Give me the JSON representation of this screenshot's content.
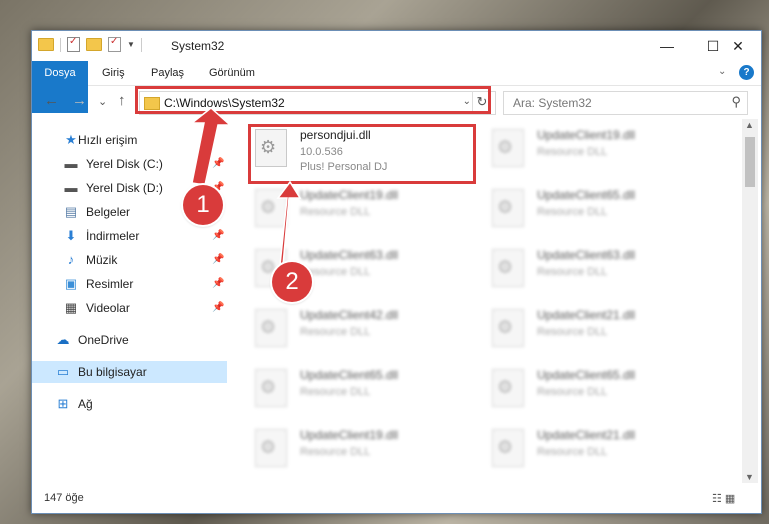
{
  "window": {
    "title": "System32",
    "minimize": "—",
    "maximize": "☐",
    "close": "✕"
  },
  "ribbon": {
    "tabs": [
      "Dosya",
      "Giriş",
      "Paylaş",
      "Görünüm"
    ],
    "help": "?"
  },
  "nav": {
    "back": "←",
    "forward": "→",
    "recent": "⌄",
    "up": "↑",
    "address": "C:\\Windows\\System32",
    "refresh": "↻",
    "search_placeholder": "Ara: System32"
  },
  "sidebar": {
    "items": [
      {
        "label": "Hızlı erişim",
        "icon": "star-icon"
      },
      {
        "label": "Yerel Disk (C:)",
        "icon": "drive-icon"
      },
      {
        "label": "Yerel Disk (D:)",
        "icon": "drive-icon"
      },
      {
        "label": "Belgeler",
        "icon": "documents-icon"
      },
      {
        "label": "İndirmeler",
        "icon": "download-icon"
      },
      {
        "label": "Müzik",
        "icon": "music-icon"
      },
      {
        "label": "Resimler",
        "icon": "pictures-icon"
      },
      {
        "label": "Videolar",
        "icon": "videos-icon"
      },
      {
        "label": "OneDrive",
        "icon": "cloud-icon"
      },
      {
        "label": "Bu bilgisayar",
        "icon": "computer-icon"
      },
      {
        "label": "Ağ",
        "icon": "network-icon"
      }
    ]
  },
  "files": [
    {
      "name": "persondjui.dll",
      "line2": "10.0.536",
      "line3": "Plus! Personal DJ"
    },
    {
      "name": "UpdateClient19.dll",
      "line2": "Resource DLL"
    },
    {
      "name": "UpdateClient19.dll",
      "line2": "Resource DLL"
    },
    {
      "name": "UpdateClient65.dll",
      "line2": "Resource DLL"
    },
    {
      "name": "UpdateClient63.dll",
      "line2": "Resource DLL"
    },
    {
      "name": "UpdateClient63.dll",
      "line2": "Resource DLL"
    },
    {
      "name": "UpdateClient42.dll",
      "line2": "Resource DLL"
    },
    {
      "name": "UpdateClient21.dll",
      "line2": "Resource DLL"
    },
    {
      "name": "UpdateClient65.dll",
      "line2": "Resource DLL"
    },
    {
      "name": "UpdateClient65.dll",
      "line2": "Resource DLL"
    },
    {
      "name": "UpdateClient19.dll",
      "line2": "Resource DLL"
    },
    {
      "name": "UpdateClient21.dll",
      "line2": "Resource DLL"
    }
  ],
  "status": {
    "count": "147 öğe"
  },
  "callouts": [
    "1",
    "2"
  ]
}
